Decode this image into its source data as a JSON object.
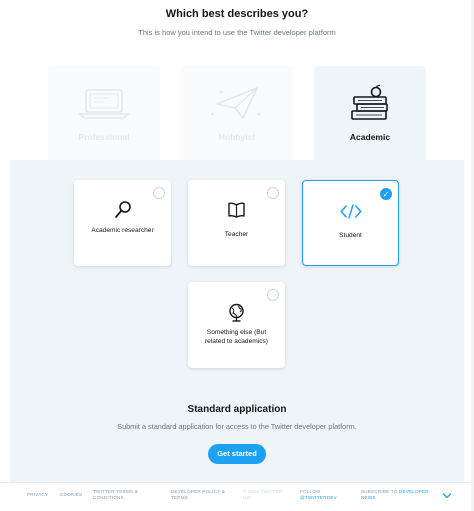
{
  "header": {
    "title": "Which best describes you?",
    "subtitle": "This is how you intend to use the Twitter developer platform"
  },
  "tabs": [
    {
      "label": "Professional",
      "icon": "laptop-icon",
      "state": "faded"
    },
    {
      "label": "Hobbyist",
      "icon": "paper-plane-icon",
      "state": "faded"
    },
    {
      "label": "Academic",
      "icon": "books-apple-icon",
      "state": "active"
    }
  ],
  "cards": [
    {
      "label": "Academic researcher",
      "icon": "magnifier-icon",
      "selected": false
    },
    {
      "label": "Teacher",
      "icon": "open-book-icon",
      "selected": false
    },
    {
      "label": "Student",
      "icon": "code-brackets-icon",
      "selected": true
    },
    {
      "label": "Something else (But related to academics)",
      "icon": "globe-icon",
      "selected": false
    }
  ],
  "application": {
    "title": "Standard application",
    "subtitle": "Submit a standard application for access to the Twitter developer platform.",
    "button_label": "Get started"
  },
  "footer": {
    "privacy": "PRIVACY",
    "cookies": "COOKIES",
    "terms_line1": "TWITTER TERMS &",
    "terms_line2": "CONDITIONS",
    "policy_line1": "DEVELOPER POLICY &",
    "policy_line2": "TERMS",
    "copyright_line1": "© 2021 TWITTER",
    "copyright_line2": "INC.",
    "follow_line1": "FOLLOW",
    "follow_line2": "@TWITTERDEV",
    "subscribe_prefix": "SUBSCRIBE TO",
    "subscribe_link1": "DEVELOPER",
    "subscribe_link2": "NEWS"
  },
  "colors": {
    "accent": "#1da1f2",
    "panel": "#eef4f8",
    "text": "#14171a",
    "muted": "#657786"
  }
}
